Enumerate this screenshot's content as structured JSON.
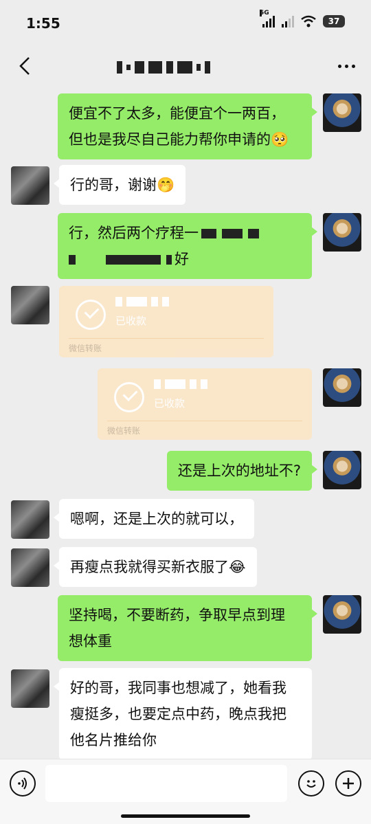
{
  "status_bar": {
    "time": "1:55",
    "network": "5G",
    "battery": "37"
  },
  "nav": {
    "back_icon": "chevron-left-icon",
    "more_icon": "more-dots-icon"
  },
  "messages": [
    {
      "side": "me",
      "lines": [
        "便宜不了太多，能便宜个一两百，",
        "但也是我尽自己能力帮你申请的🥺"
      ]
    },
    {
      "side": "other",
      "lines": [
        "行的哥，谢谢🤭"
      ]
    },
    {
      "side": "me",
      "line1": "行，然后两个疗程一",
      "line2_end": "好"
    },
    {
      "side": "other",
      "type": "transfer",
      "status": "已收款",
      "footer": "微信转账"
    },
    {
      "side": "me",
      "type": "transfer",
      "status": "已收款",
      "footer": "微信转账"
    },
    {
      "side": "me",
      "lines": [
        "还是上次的地址不?"
      ]
    },
    {
      "side": "other",
      "lines": [
        "嗯啊，还是上次的就可以，"
      ]
    },
    {
      "side": "other",
      "lines": [
        "再瘦点我就得买新衣服了😂"
      ]
    },
    {
      "side": "me",
      "lines": [
        "坚持喝，不要断药，争取早点到理",
        "想体重"
      ]
    },
    {
      "side": "other",
      "lines": [
        "好的哥，我同事也想减了，她看我",
        "瘦挺多，也要定点中药，晚点我把",
        "他名片推给你"
      ]
    }
  ],
  "input_bar": {
    "voice_icon": "voice-icon",
    "emoji_icon": "emoji-icon",
    "plus_icon": "plus-icon",
    "placeholder": ""
  }
}
